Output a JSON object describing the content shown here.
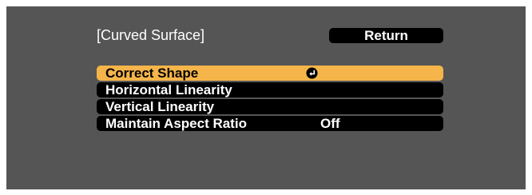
{
  "header": {
    "title": "[Curved Surface]",
    "return_label": "Return"
  },
  "menu": {
    "items": [
      {
        "label": "Correct Shape",
        "value": "",
        "icon": "enter-icon",
        "selected": true
      },
      {
        "label": "Horizontal Linearity",
        "value": ""
      },
      {
        "label": "Vertical Linearity",
        "value": ""
      },
      {
        "label": "Maintain Aspect Ratio",
        "value": "Off"
      }
    ]
  },
  "colors": {
    "panel_background": "#555555",
    "item_background": "#000000",
    "selected_background": "#f5b54a",
    "text": "#ffffff",
    "selected_text": "#000000"
  }
}
